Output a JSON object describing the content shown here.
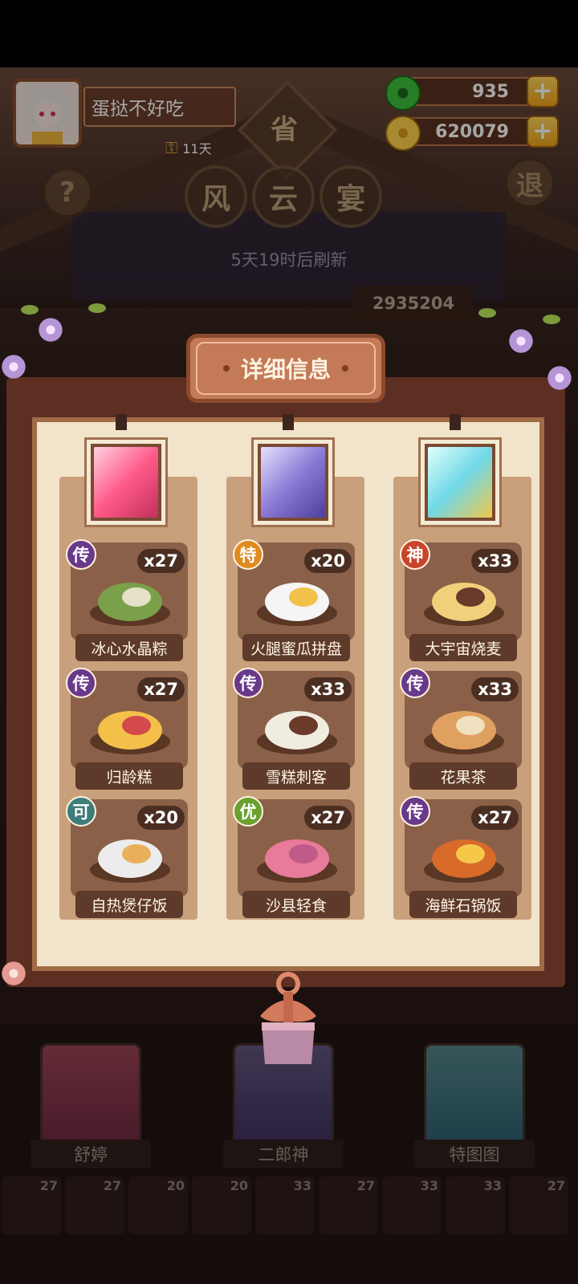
{
  "player": {
    "name": "蛋挞不好吃",
    "days": "11天"
  },
  "currency": {
    "jade": "935",
    "coins": "620079"
  },
  "buttons": {
    "help": "?",
    "exit": "退",
    "plus": "+"
  },
  "banner": {
    "province": "省",
    "title_chars": [
      "风",
      "云",
      "宴"
    ],
    "refresh": "5天19时后刷新",
    "score": "2935204"
  },
  "panel": {
    "title": "详细信息"
  },
  "columns": [
    {
      "chef": "舒婷",
      "dishes": [
        {
          "rank": "传",
          "rank_color": "#6a3a8a",
          "count": "x27",
          "name": "冰心水晶粽"
        },
        {
          "rank": "传",
          "rank_color": "#6a3a8a",
          "count": "x27",
          "name": "归龄糕"
        },
        {
          "rank": "可",
          "rank_color": "#3f7d7a",
          "count": "x20",
          "name": "自热煲仔饭"
        }
      ]
    },
    {
      "chef": "二郎神",
      "dishes": [
        {
          "rank": "特",
          "rank_color": "#e08a1f",
          "count": "x20",
          "name": "火腿蜜瓜拼盘"
        },
        {
          "rank": "传",
          "rank_color": "#6a3a8a",
          "count": "x33",
          "name": "雪糕刺客"
        },
        {
          "rank": "优",
          "rank_color": "#6aa02d",
          "count": "x27",
          "name": "沙县轻食"
        }
      ]
    },
    {
      "chef": "特图图",
      "dishes": [
        {
          "rank": "神",
          "rank_color": "#c8452a",
          "count": "x33",
          "name": "大宇宙烧麦"
        },
        {
          "rank": "传",
          "rank_color": "#6a3a8a",
          "count": "x33",
          "name": "花果茶"
        },
        {
          "rank": "传",
          "rank_color": "#6a3a8a",
          "count": "x27",
          "name": "海鲜石锅饭"
        }
      ]
    }
  ],
  "bottom_slots": [
    "27",
    "27",
    "20",
    "20",
    "33",
    "27",
    "33",
    "33",
    "27"
  ]
}
